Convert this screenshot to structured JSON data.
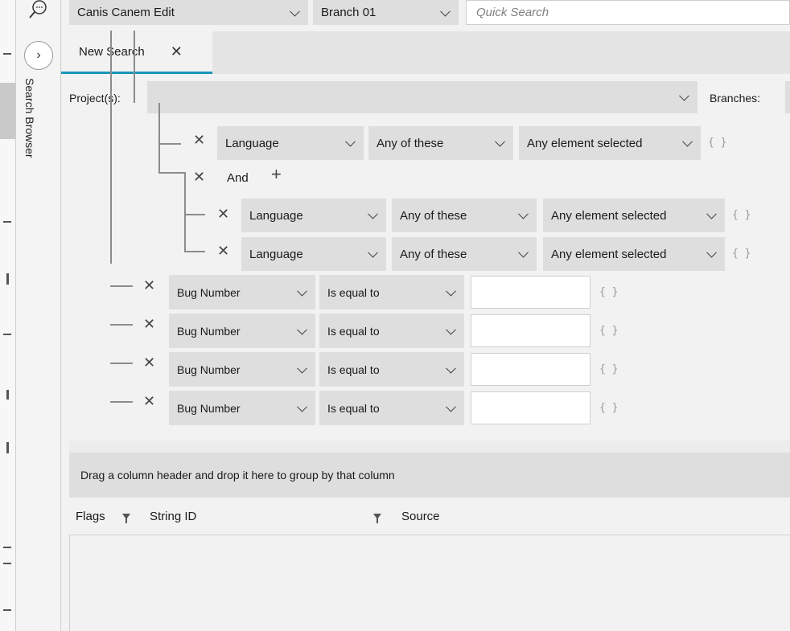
{
  "sidebar": {
    "panel_label": "Search Browser",
    "expand_icon": "chevron-right-icon",
    "search_icon": "search-chat-icon"
  },
  "toolbar": {
    "project": "Canis Canem Edit",
    "branch": "Branch 01",
    "quick_search_placeholder": "Quick Search"
  },
  "tabs": [
    {
      "label": "New Search",
      "close_icon": "close-icon"
    }
  ],
  "filter": {
    "projects_label": "Project(s):",
    "projects_value": "",
    "branches_label": "Branches:",
    "group_operator": "And",
    "add_icon": "plus-icon",
    "braces": "{}",
    "conditions": [
      {
        "field": "Language",
        "operator": "Any of these",
        "value": "Any element selected"
      },
      {
        "field": "Language",
        "operator": "Any of these",
        "value": "Any element selected"
      },
      {
        "field": "Language",
        "operator": "Any of these",
        "value": "Any element selected"
      },
      {
        "field": "Bug Number",
        "operator": "Is equal to",
        "value": ""
      },
      {
        "field": "Bug Number",
        "operator": "Is equal to",
        "value": ""
      },
      {
        "field": "Bug Number",
        "operator": "Is equal to",
        "value": ""
      },
      {
        "field": "Bug Number",
        "operator": "Is equal to",
        "value": ""
      }
    ]
  },
  "results": {
    "group_hint": "Drag a column header and drop it here to group by that column",
    "columns": [
      "Flags",
      "String ID",
      "Source"
    ],
    "filter_icon": "filter-icon"
  }
}
